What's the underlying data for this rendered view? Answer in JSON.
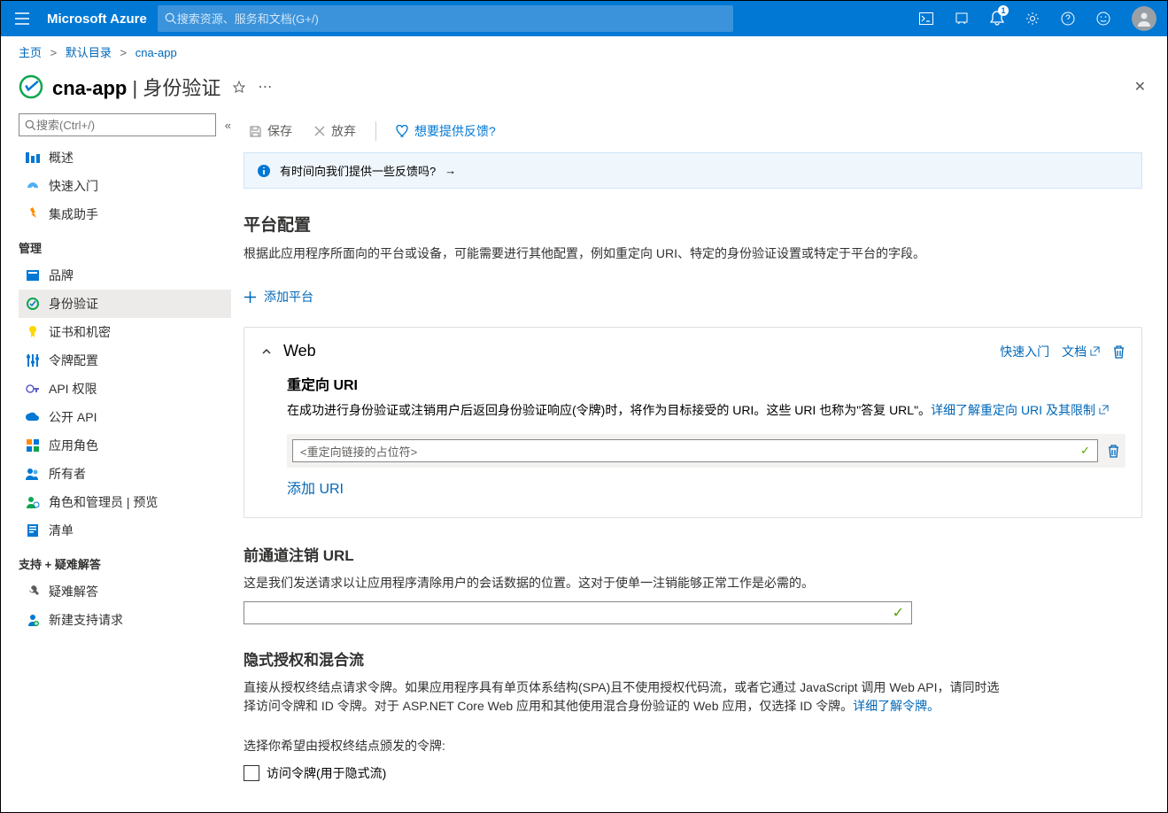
{
  "header": {
    "brand": "Microsoft Azure",
    "search_placeholder": "搜索资源、服务和文档(G+/)",
    "notification_count": "1"
  },
  "breadcrumb": {
    "home": "主页",
    "dir": "默认目录",
    "app": "cna-app"
  },
  "page": {
    "app": "cna-app",
    "section": "身份验证"
  },
  "sidebar": {
    "search_placeholder": "搜索(Ctrl+/)",
    "items": {
      "overview": "概述",
      "quickstart": "快速入门",
      "integration": "集成助手"
    },
    "mgmt_label": "管理",
    "mgmt": {
      "brand": "品牌",
      "auth": "身份验证",
      "cert": "证书和机密",
      "token": "令牌配置",
      "apiperm": "API 权限",
      "expose": "公开 API",
      "roles": "应用角色",
      "owners": "所有者",
      "admins": "角色和管理员 | 预览",
      "manifest": "清单"
    },
    "support_label": "支持 + 疑难解答",
    "support": {
      "trouble": "疑难解答",
      "newreq": "新建支持请求"
    }
  },
  "toolbar": {
    "save": "保存",
    "discard": "放弃",
    "feedback": "想要提供反馈?"
  },
  "banner": {
    "text": "有时间向我们提供一些反馈吗?"
  },
  "platform": {
    "title": "平台配置",
    "desc": "根据此应用程序所面向的平台或设备，可能需要进行其他配置，例如重定向 URI、特定的身份验证设置或特定于平台的字段。",
    "add": "添加平台"
  },
  "web": {
    "title": "Web",
    "quickstart": "快速入门",
    "docs": "文档",
    "redirect_title": "重定向 URI",
    "redirect_desc": "在成功进行身份验证或注销用户后返回身份验证响应(令牌)时，将作为目标接受的 URI。这些 URI 也称为\"答复 URL\"。",
    "redirect_link": "详细了解重定向 URI 及其限制",
    "uri_placeholder": "<重定向链接的占位符>",
    "add_uri": "添加 URI"
  },
  "logout": {
    "title": "前通道注销 URL",
    "desc": "这是我们发送请求以让应用程序清除用户的会话数据的位置。这对于使单一注销能够正常工作是必需的。"
  },
  "implicit": {
    "title": "隐式授权和混合流",
    "desc": "直接从授权终结点请求令牌。如果应用程序具有单页体系结构(SPA)且不使用授权代码流，或者它通过 JavaScript 调用 Web API，请同时选择访问令牌和 ID 令牌。对于 ASP.NET Core Web 应用和其他使用混合身份验证的 Web 应用，仅选择 ID 令牌。",
    "link": "详细了解令牌",
    "select_label": "选择你希望由授权终结点颁发的令牌:",
    "access_token": "访问令牌(用于隐式流)"
  }
}
